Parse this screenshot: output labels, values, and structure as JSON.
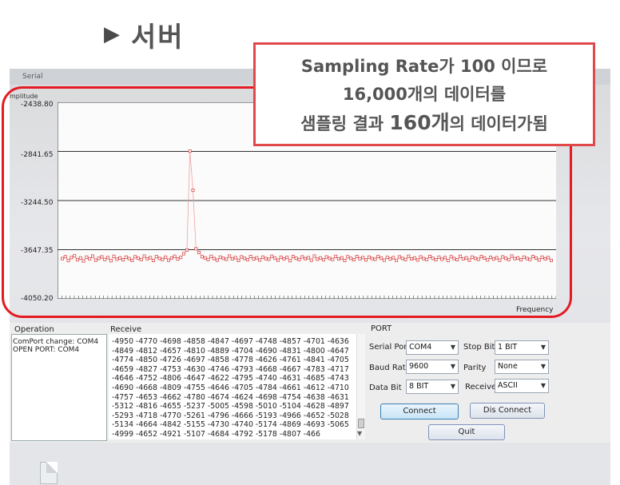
{
  "heading": {
    "marker": "▶",
    "text": "서버"
  },
  "window": {
    "title": "Serial"
  },
  "chart": {
    "y_label": "mplitude",
    "x_label": "Frequency",
    "y_ticks": [
      "-2438.80",
      "-2841.65",
      "-3244.50",
      "-3647.35",
      "-4050.20"
    ]
  },
  "callout": {
    "line1": "Sampling Rate가 100 이므로",
    "line2": "16,000개의 데이터를",
    "line3_a": "샘플링 결과 ",
    "line3_b": "160개",
    "line3_c": "의 데이터가됨"
  },
  "operation": {
    "label": "Operation",
    "lines": [
      "ComPort change: COM4",
      "OPEN PORT: COM4"
    ]
  },
  "receive": {
    "label": "Receive",
    "lines": [
      "-4950 -4770 -4698 -4858 -4847 -4697 -4748 -4857 -4701 -4636",
      "-4849 -4812 -4657 -4810 -4889 -4704 -4690 -4831 -4800 -4647",
      "-4774 -4850 -4726 -4697 -4858 -4778 -4626 -4761 -4841 -4705",
      "-4659 -4827 -4753 -4630 -4746 -4793 -4668 -4667 -4783 -4717",
      "-4646 -4752 -4806 -4647 -4622 -4795 -4740 -4631 -4685 -4743",
      "-4690 -4668 -4809 -4755 -4646 -4705 -4784 -4661 -4612 -4710",
      "-4757 -4653 -4662 -4780 -4674 -4624 -4698 -4754 -4638 -4631",
      "-5312 -4816 -4655 -5237 -5005 -4598 -5010 -5104 -4628 -4897",
      "-5293 -4718 -4770 -5261 -4796 -4666 -5193 -4966 -4652 -5028",
      "-5134 -4664 -4842 -5155 -4730 -4740 -5174 -4869 -4693 -5065",
      "-4999 -4652 -4921 -5107 -4684 -4792 -5178 -4807 -466"
    ]
  },
  "port": {
    "label": "PORT",
    "serial_port": {
      "label": "Serial Port",
      "value": "COM4"
    },
    "stop_bit": {
      "label": "Stop Bit",
      "value": "1 BIT"
    },
    "baud_rate": {
      "label": "Baud Rate",
      "value": "9600"
    },
    "parity": {
      "label": "Parity",
      "value": "None"
    },
    "data_bit": {
      "label": "Data Bit",
      "value": "8 BIT"
    },
    "receive": {
      "label": "Receive",
      "value": "ASCII"
    },
    "connect_label": "Connect",
    "disconnect_label": "Dis Connect",
    "quit_label": "Quit"
  },
  "chart_data": {
    "type": "scatter",
    "ylabel": "mplitude",
    "xlabel": "Frequency",
    "ylim": [
      -4050.2,
      -2438.8
    ],
    "x": [
      0,
      1,
      2,
      3,
      4,
      5,
      6,
      7,
      8,
      9,
      10,
      11,
      12,
      13,
      14,
      15,
      16,
      17,
      18,
      19,
      20,
      21,
      22,
      23,
      24,
      25,
      26,
      27,
      28,
      29,
      30,
      31,
      32,
      33,
      34,
      35,
      36,
      37,
      38,
      39,
      40,
      41,
      42,
      43,
      44,
      45,
      46,
      47,
      48,
      49,
      50,
      51,
      52,
      53,
      54,
      55,
      56,
      57,
      58,
      59,
      60,
      61,
      62,
      63,
      64,
      65,
      66,
      67,
      68,
      69,
      70,
      71,
      72,
      73,
      74,
      75,
      76,
      77,
      78,
      79,
      80,
      81,
      82,
      83,
      84,
      85,
      86,
      87,
      88,
      89,
      90,
      91,
      92,
      93,
      94,
      95,
      96,
      97,
      98,
      99,
      100,
      101,
      102,
      103,
      104,
      105,
      106,
      107,
      108,
      109,
      110,
      111,
      112,
      113,
      114,
      115,
      116,
      117,
      118,
      119,
      120,
      121,
      122,
      123,
      124,
      125,
      126,
      127,
      128,
      129,
      130,
      131,
      132,
      133,
      134,
      135,
      136,
      137,
      138,
      139,
      140,
      141,
      142,
      143,
      144,
      145,
      146,
      147,
      148,
      149,
      150,
      151,
      152,
      153,
      154,
      155,
      156,
      157,
      158,
      159
    ],
    "y": [
      -3720,
      -3705,
      -3735,
      -3712,
      -3698,
      -3730,
      -3715,
      -3740,
      -3708,
      -3722,
      -3700,
      -3733,
      -3718,
      -3706,
      -3728,
      -3712,
      -3738,
      -3702,
      -3725,
      -3715,
      -3730,
      -3708,
      -3720,
      -3735,
      -3705,
      -3718,
      -3728,
      -3700,
      -3722,
      -3713,
      -3736,
      -3704,
      -3719,
      -3727,
      -3709,
      -3733,
      -3716,
      -3701,
      -3724,
      -3711,
      -3680,
      -3650,
      -2840,
      -3160,
      -3640,
      -3670,
      -3705,
      -3715,
      -3728,
      -3702,
      -3720,
      -3733,
      -3708,
      -3718,
      -3726,
      -3700,
      -3722,
      -3712,
      -3735,
      -3706,
      -3719,
      -3729,
      -3703,
      -3724,
      -3714,
      -3732,
      -3708,
      -3720,
      -3726,
      -3701,
      -3717,
      -3733,
      -3709,
      -3723,
      -3711,
      -3737,
      -3704,
      -3718,
      -3728,
      -3706,
      -3721,
      -3713,
      -3734,
      -3700,
      -3725,
      -3715,
      -3730,
      -3707,
      -3719,
      -3727,
      -3702,
      -3723,
      -3714,
      -3736,
      -3705,
      -3718,
      -3729,
      -3703,
      -3722,
      -3712,
      -3731,
      -3708,
      -3720,
      -3726,
      -3704,
      -3717,
      -3733,
      -3710,
      -3724,
      -3713,
      -3735,
      -3706,
      -3719,
      -3728,
      -3701,
      -3723,
      -3715,
      -3732,
      -3707,
      -3721,
      -3727,
      -3703,
      -3718,
      -3730,
      -3709,
      -3725,
      -3712,
      -3736,
      -3705,
      -3720,
      -3729,
      -3702,
      -3722,
      -3714,
      -3733,
      -3708,
      -3719,
      -3726,
      -3704,
      -3716,
      -3731,
      -3710,
      -3724,
      -3713,
      -3734,
      -3706,
      -3718,
      -3728,
      -3700,
      -3721,
      -3715,
      -3730,
      -3708,
      -3720,
      -3727,
      -3703,
      -3717,
      -3732,
      -3709,
      -3723,
      -3712,
      -3735
    ]
  }
}
